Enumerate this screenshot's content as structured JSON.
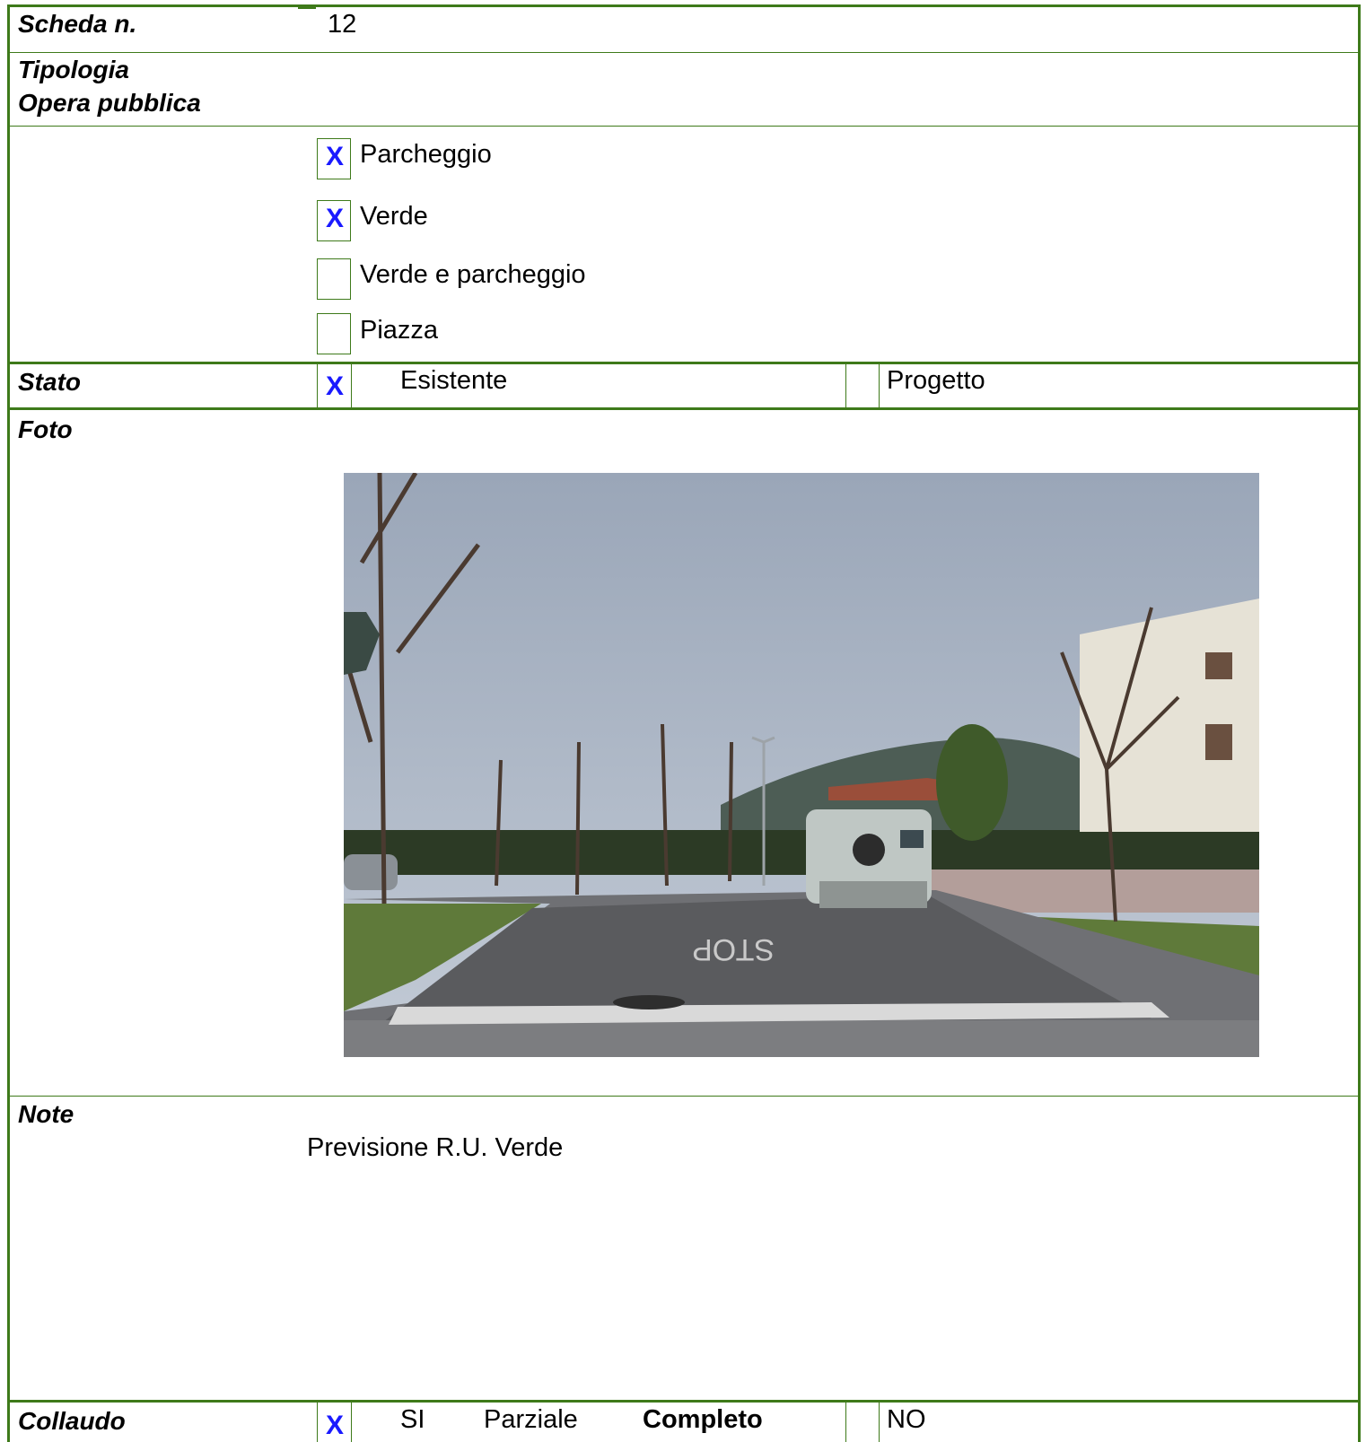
{
  "header": {
    "scheda_label": "Scheda n.",
    "scheda_value": "12"
  },
  "tipologia": {
    "label_line1": "Tipologia",
    "label_line2": "Opera pubblica",
    "options": [
      {
        "label": "Parcheggio",
        "mark": "X"
      },
      {
        "label": "Verde",
        "mark": "X"
      },
      {
        "label": "Verde e parcheggio",
        "mark": ""
      },
      {
        "label": "Piazza",
        "mark": ""
      }
    ]
  },
  "stato": {
    "label": "Stato",
    "mark": "X",
    "option1": "Esistente",
    "option2": "Progetto"
  },
  "foto": {
    "label": "Foto"
  },
  "note": {
    "label": "Note",
    "text": "Previsione R.U. Verde"
  },
  "collaudo": {
    "label": "Collaudo",
    "mark": "X",
    "si": "SI",
    "parziale": "Parziale",
    "completo": "Completo",
    "no": "NO"
  },
  "colors": {
    "border": "#3e7a1a",
    "check": "#1a1aff"
  }
}
